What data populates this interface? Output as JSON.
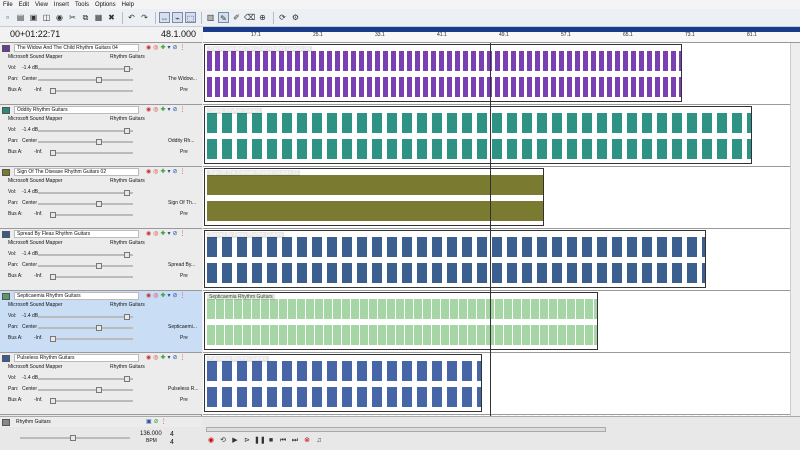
{
  "menu": [
    "File",
    "Edit",
    "View",
    "Insert",
    "Tools",
    "Options",
    "Help"
  ],
  "toolbar_icons": [
    "new-icon",
    "open-icon",
    "save-icon",
    "properties-icon",
    "render-icon",
    "cut-icon",
    "copy-icon",
    "paste-icon",
    "delete-icon",
    "undo-icon",
    "redo-icon",
    "edit-tool-icon",
    "envelope-tool-icon",
    "select-tool-icon",
    "snap-icon",
    "draw-icon",
    "pencil-icon",
    "erase-icon",
    "zoom-icon",
    "loop-icon",
    "settings-icon"
  ],
  "time_display": "00+01:22:71",
  "beat_display": "48.1.000",
  "ruler_ticks": [
    "17.1",
    "25.1",
    "33.1",
    "41.1",
    "49.1",
    "57.1",
    "65.1",
    "73.1",
    "81.1"
  ],
  "tracks": [
    {
      "name": "The Widow And The Child Rhythm Guitars 04",
      "device": "Microsoft Sound Mapper",
      "input": "Rhythm Guitars",
      "vol": "-1.4 dB",
      "pan": "Center",
      "bus": "-Inf.",
      "send": "The Widow...",
      "pre": "Pre",
      "color": "#6a3a9a",
      "clip_color": "#7a3fb0"
    },
    {
      "name": "Oddity Rhythm Guitars",
      "device": "Microsoft Sound Mapper",
      "input": "Rhythm Guitars",
      "vol": "-1.4 dB",
      "pan": "Center",
      "bus": "-Inf.",
      "send": "Oddity Rh...",
      "pre": "Pre",
      "color": "#2a8a7a",
      "clip_color": "#2e9384"
    },
    {
      "name": "Sign Of The Disease Rhythm Guitars 02",
      "device": "Microsoft Sound Mapper",
      "input": "Rhythm Guitars",
      "vol": "-1.4 dB",
      "pan": "Center",
      "bus": "-Inf.",
      "send": "Sign Of Th...",
      "pre": "Pre",
      "color": "#7a7a2a",
      "clip_color": "#7a7a30"
    },
    {
      "name": "Spread By Fleas Rhythm Guitars",
      "device": "Microsoft Sound Mapper",
      "input": "Rhythm Guitars",
      "vol": "-1.4 dB",
      "pan": "Center",
      "bus": "-Inf.",
      "send": "Spread By...",
      "pre": "Pre",
      "color": "#3a5a8a",
      "clip_color": "#3b5f8f"
    },
    {
      "name": "Septicaemia Rhythm Guitars",
      "device": "Microsoft Sound Mapper",
      "input": "Rhythm Guitars",
      "vol": "-1.4 dB",
      "pan": "Center",
      "bus": "-Inf.",
      "send": "Septicaemi...",
      "pre": "Pre",
      "color": "#5a9a6a",
      "clip_color": "#a6d6a6"
    },
    {
      "name": "Pulseless Rhythm Guitars",
      "device": "Microsoft Sound Mapper",
      "input": "Rhythm Guitars",
      "vol": "-1.4 dB",
      "pan": "Center",
      "bus": "-Inf.",
      "send": "Pulseless R...",
      "pre": "Pre",
      "color": "#3a5a9a",
      "clip_color": "#4666a8"
    }
  ],
  "bus_track": {
    "name": "Rhythm Guitars"
  },
  "labels": {
    "vol": "Vol:",
    "pan": "Pan:",
    "bus": "Bus A:"
  },
  "tempo": {
    "bpm": "136.000",
    "bpm_label": "BPM",
    "sig_top": "4",
    "sig_bottom": "4"
  }
}
